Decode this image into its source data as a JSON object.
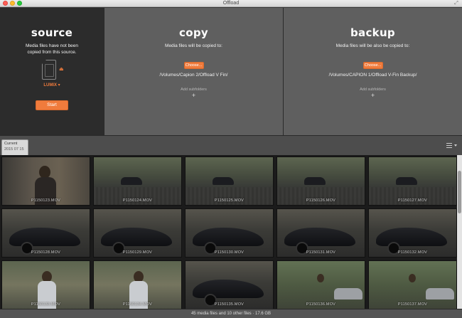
{
  "window": {
    "title": "Offload"
  },
  "source": {
    "heading": "source",
    "description": "Media files have not been copied from this source.",
    "card_label": "LUMIX ▾",
    "start_label": "Start"
  },
  "copy": {
    "heading": "copy",
    "description": "Media files will be copied to:",
    "choose_label": "Choose...",
    "path": "/Volumes/Capion 2/Offload V Fin/",
    "add_subfolders": "Add subfolders",
    "plus": "+"
  },
  "backup": {
    "heading": "backup",
    "description": "Media files will be also be copied to:",
    "choose_label": "Choose...",
    "path": "/Volumes/CAPION 1/Offload V-Fin Backup/",
    "add_subfolders": "Add subfolders",
    "plus": "+"
  },
  "tab": {
    "label": "Current",
    "date": "2015 07 15"
  },
  "thumbnails": [
    {
      "name": "P1150123.MOV",
      "scene": "woman"
    },
    {
      "name": "P1150124.MOV",
      "scene": "street"
    },
    {
      "name": "P1150125.MOV",
      "scene": "street"
    },
    {
      "name": "P1150126.MOV",
      "scene": "street"
    },
    {
      "name": "P1150127.MOV",
      "scene": "street"
    },
    {
      "name": "P1150128.MOV",
      "scene": "car"
    },
    {
      "name": "P1150129.MOV",
      "scene": "car"
    },
    {
      "name": "P1150130.MOV",
      "scene": "car"
    },
    {
      "name": "P1150131.MOV",
      "scene": "car"
    },
    {
      "name": "P1150132.MOV",
      "scene": "car"
    },
    {
      "name": "P1150133.MOV",
      "scene": "woman-out"
    },
    {
      "name": "P1150134.MOV",
      "scene": "woman-out"
    },
    {
      "name": "P1150135.MOV",
      "scene": "car"
    },
    {
      "name": "P1150136.MOV",
      "scene": "park"
    },
    {
      "name": "P1150137.MOV",
      "scene": "park"
    }
  ],
  "status": "45 media files and 10 other files · 17.6 GB",
  "colors": {
    "accent": "#f07b3c",
    "panel": "#5f5f5f",
    "source_panel": "#2c2c2c"
  }
}
